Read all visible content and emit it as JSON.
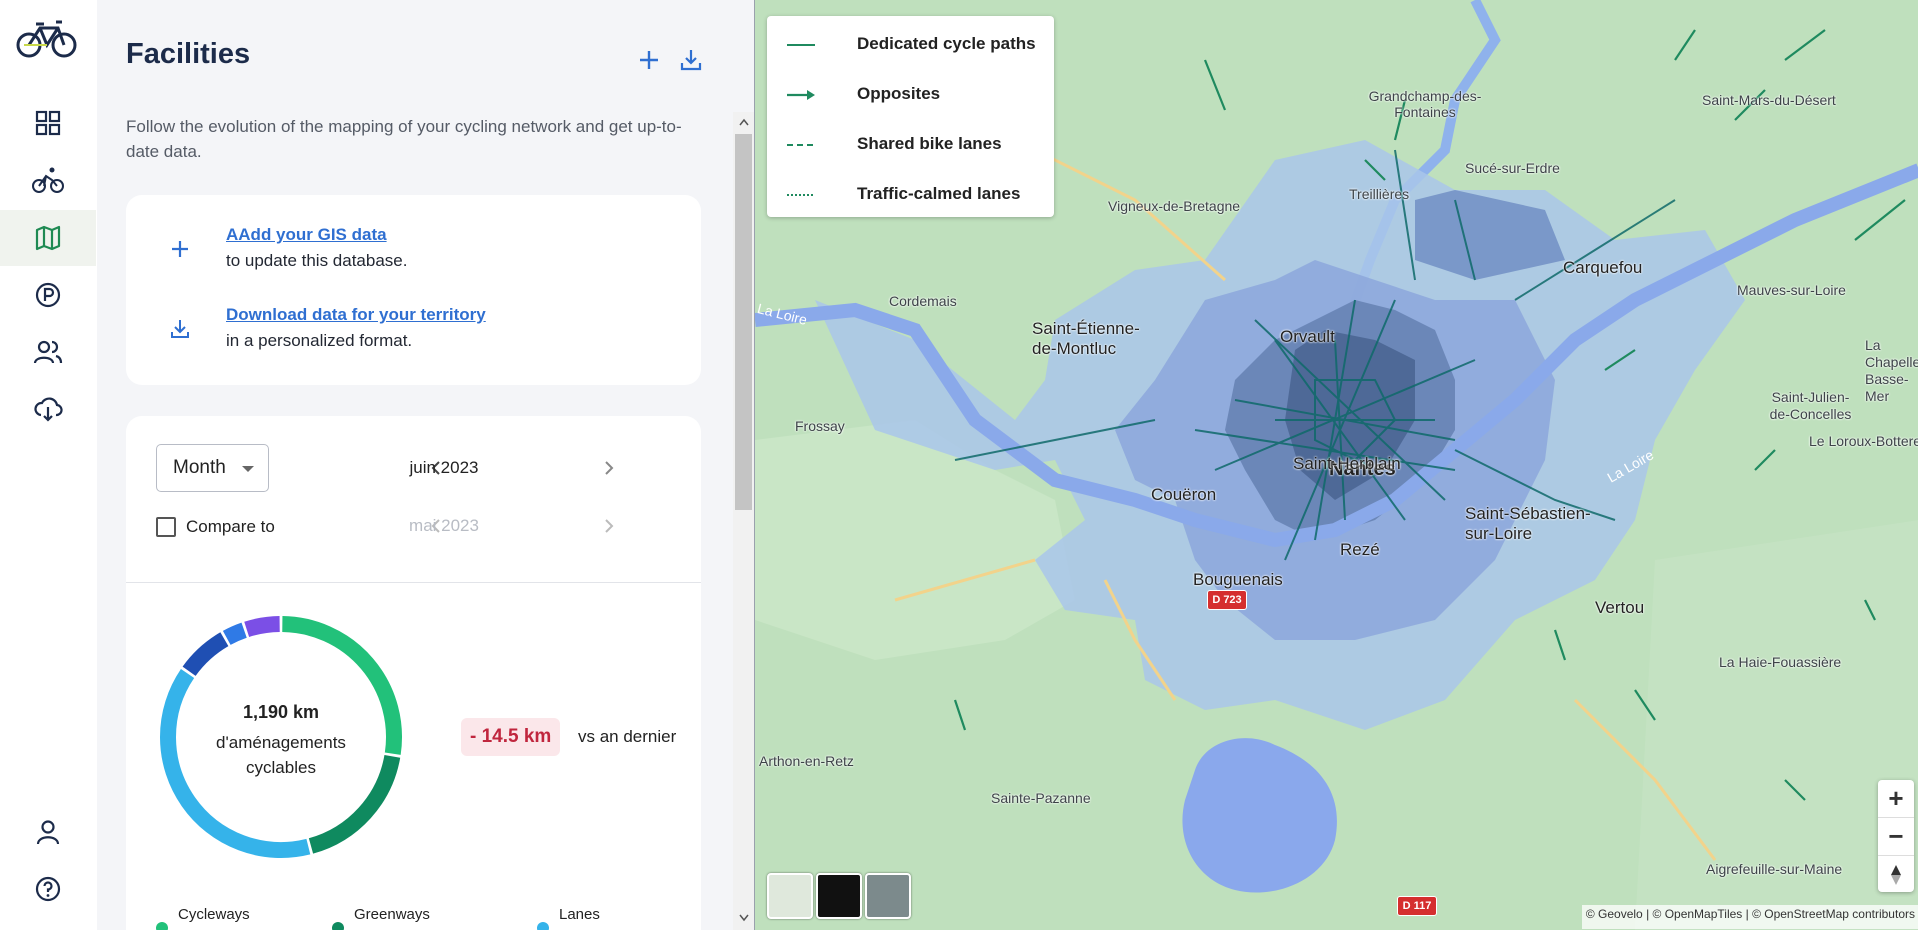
{
  "sidebar": {
    "title": "Facilities",
    "intro": "Follow the evolution of the mapping of your cycling network and get up-to-date data.",
    "actions": [
      {
        "link": "AAdd your GIS data",
        "sub": "to update this database."
      },
      {
        "link": "Download data for your territory",
        "sub": "in a personalized format."
      }
    ]
  },
  "controls": {
    "period": "Month",
    "current_period": "juin 2023",
    "compare_label": "Compare to",
    "compare_period": "mai 2023"
  },
  "stats": {
    "total": "1,190 km",
    "caption": "d'aménagements cyclables",
    "delta": "- 14.5 km",
    "delta_caption": "vs an dernier"
  },
  "chart_data": {
    "type": "pie",
    "title": "",
    "series": [
      {
        "name": "Cycleways",
        "value": 27,
        "color": "#22c17a"
      },
      {
        "name": "Greenways",
        "value": 18,
        "color": "#0f8a5f"
      },
      {
        "name": "Lanes",
        "value": 38,
        "color": "#35b3ea"
      },
      {
        "name": "",
        "value": 7,
        "color": "#1f4fb3"
      },
      {
        "name": "",
        "value": 3,
        "color": "#2f7ae6"
      },
      {
        "name": "",
        "value": 5,
        "color": "#7b4fe6"
      }
    ],
    "legend_visible": [
      "Cycleways",
      "Greenways",
      "Lanes"
    ]
  },
  "map": {
    "legend": [
      "Dedicated cycle paths",
      "Opposites",
      "Shared bike lanes",
      "Traffic-calmed lanes"
    ],
    "labels": {
      "nantes": "Nantes",
      "reze": "Rezé",
      "saint_herblain": "Saint-Herblain",
      "saint_sebastien": "Saint-Sébastien-sur-Loire",
      "orvault": "Orvault",
      "carquefou": "Carquefou",
      "coueron": "Couëron",
      "bouguenais": "Bouguenais",
      "vertou": "Vertou",
      "saint_etienne": "Saint-Étienne-de-Montluc",
      "cordemais": "Cordemais",
      "frossay": "Frossay",
      "vigneux": "Vigneux-de-Bretagne",
      "treillieres": "Treillières",
      "grandchamp": "Grandchamp-des-Fontaines",
      "suce": "Sucé-sur-Erdre",
      "saint_mars": "Saint-Mars-du-Désert",
      "mauves": "Mauves-sur-Loire",
      "la_chapelle": "La Chapelle-Basse-Mer",
      "saint_julien": "Saint-Julien-de-Concelles",
      "le_loroux": "Le Loroux-Bottereau",
      "la_haie": "La Haie-Fouassière",
      "arthon": "Arthon-en-Retz",
      "sainte_pazanne": "Sainte-Pazanne",
      "aigrefeuille": "Aigrefeuille-sur-Maine",
      "la_loire": "La Loire",
      "la_loire2": "La Loire",
      "d723": "D 723",
      "d117": "D 117"
    },
    "zoom_in": "+",
    "zoom_out": "−",
    "attribution": "© Geovelo | © OpenMapTiles | © OpenStreetMap contributors"
  }
}
